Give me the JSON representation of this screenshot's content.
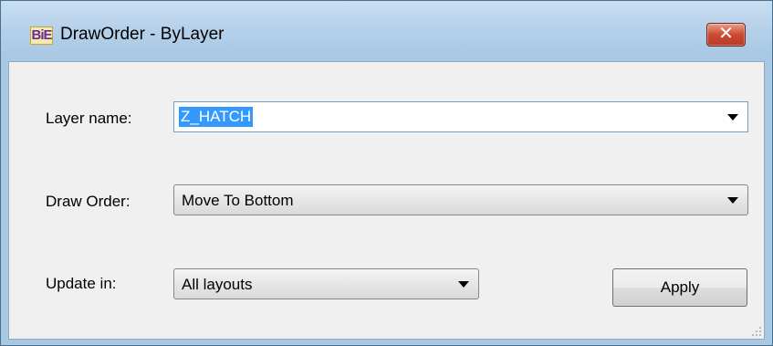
{
  "window": {
    "icon_text": "BiE",
    "title": "DrawOrder - ByLayer",
    "close_glyph": "✕"
  },
  "form": {
    "layer_name": {
      "label": "Layer name:",
      "value": "Z_HATCH"
    },
    "draw_order": {
      "label": "Draw Order:",
      "value": "Move To Bottom"
    },
    "update_in": {
      "label": "Update in:",
      "value": "All layouts"
    },
    "apply_label": "Apply"
  },
  "icons": {
    "app": "app-logo-icon",
    "close": "close-icon",
    "dropdown": "chevron-down-icon",
    "resize": "resize-grip-icon"
  },
  "colors": {
    "title_bar": "#b6d1ea",
    "close_button": "#cc4a32",
    "selection": "#3399ff",
    "dialog_bg": "#f0f0f0"
  }
}
